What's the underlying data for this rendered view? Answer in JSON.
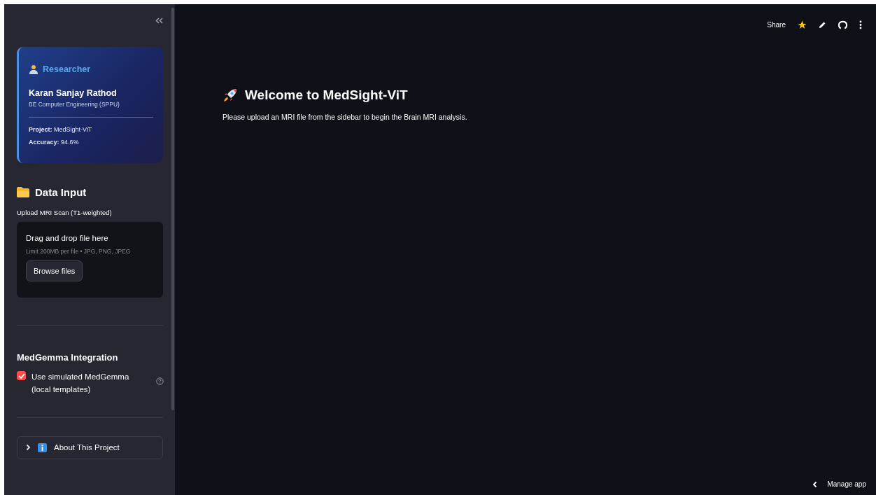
{
  "sidebar": {
    "researcher_card": {
      "title": "Researcher",
      "name": "Karan Sanjay Rathod",
      "degree": "BE Computer Engineering (SPPU)",
      "lines": [
        "**Project:** MedSight-ViT",
        "**Accuracy:** 94.6%"
      ]
    },
    "data_input": {
      "heading": "Data Input",
      "uploader_label": "Upload MRI Scan (T1-weighted)",
      "dropzone_title": "Drag and drop file here",
      "dropzone_hint": "Limit 200MB per file • JPG, PNG, JPEG",
      "browse_button": "Browse files"
    },
    "integration": {
      "heading": "MedGemma Integration",
      "checkbox": {
        "label": "Use simulated MedGemma (local templates)",
        "checked": true
      }
    },
    "expander": {
      "label": "About This Project",
      "expanded": false
    }
  },
  "main": {
    "title": "Welcome to MedSight-ViT",
    "text": "Please upload an MRI file from the sidebar to begin the Brain MRI analysis."
  },
  "toolbar": {
    "share": "Share"
  },
  "footer": {
    "manage": "Manage app"
  }
}
